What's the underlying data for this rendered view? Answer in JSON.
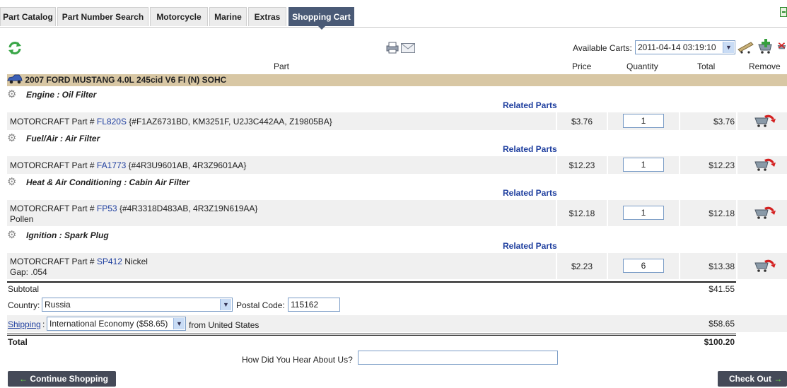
{
  "tabs": [
    "Part Catalog",
    "Part Number Search",
    "Motorcycle",
    "Marine",
    "Extras",
    "Shopping Cart"
  ],
  "carts": {
    "label": "Available Carts:",
    "selected": "2011-04-14 03:19:10"
  },
  "columns": {
    "part": "Part",
    "price": "Price",
    "quantity": "Quantity",
    "total": "Total",
    "remove": "Remove"
  },
  "vehicle": "2007 FORD MUSTANG 4.0L 245cid V6 FI (N) SOHC",
  "items": [
    {
      "category": "Engine : Oil Filter",
      "related": "Related Parts",
      "prefix": "MOTORCRAFT Part #",
      "number": "FL820S",
      "desc": "{#F1AZ6731BD, KM3251F, U2J3C442AA, Z19805BA}",
      "note": "",
      "price": "$3.76",
      "qty": "1",
      "total": "$3.76"
    },
    {
      "category": "Fuel/Air : Air Filter",
      "related": "Related Parts",
      "prefix": "MOTORCRAFT Part #",
      "number": "FA1773",
      "desc": "{#4R3U9601AB, 4R3Z9601AA}",
      "note": "",
      "price": "$12.23",
      "qty": "1",
      "total": "$12.23"
    },
    {
      "category": "Heat & Air Conditioning : Cabin Air Filter",
      "related": "Related Parts",
      "prefix": "MOTORCRAFT Part #",
      "number": "FP53",
      "desc": "{#4R3318D483AB, 4R3Z19N619AA}",
      "note": "Pollen",
      "price": "$12.18",
      "qty": "1",
      "total": "$12.18"
    },
    {
      "category": "Ignition : Spark Plug",
      "related": "Related Parts",
      "prefix": "MOTORCRAFT Part #",
      "number": "SP412",
      "desc": "Nickel",
      "note": "Gap: .054",
      "price": "$2.23",
      "qty": "6",
      "total": "$13.38"
    }
  ],
  "subtotal": {
    "label": "Subtotal",
    "value": "$41.55"
  },
  "country": {
    "label": "Country:",
    "value": "Russia"
  },
  "postal": {
    "label": "Postal Code:",
    "value": "115162"
  },
  "shipping": {
    "label": "Shipping",
    "value": "International Economy ($58.65)",
    "from": "from United States",
    "cost": "$58.65"
  },
  "grand_total": {
    "label": "Total",
    "value": "$100.20"
  },
  "hear": {
    "label": "How Did You Hear About Us?",
    "value": ""
  },
  "buttons": {
    "continue": "Continue Shopping",
    "checkout": "Check Out"
  },
  "colors": {
    "tab_active": "#4a5a76",
    "vehicle_bar": "#d8c7a4",
    "link": "#1f3f9f",
    "button": "#454a58"
  }
}
